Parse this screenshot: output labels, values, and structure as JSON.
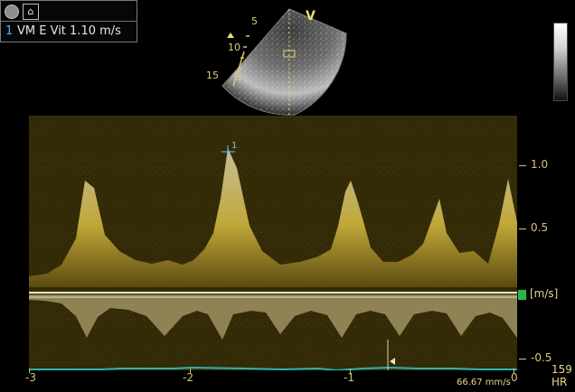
{
  "top_panel": {
    "record_icon": "record-icon",
    "patient_icon": "patient-icon",
    "measurement": {
      "index": "1",
      "label": "VM E Vit  1.10 m/s"
    }
  },
  "sector": {
    "mode_label": "V",
    "depth_labels": [
      "5",
      "10",
      "15"
    ]
  },
  "doppler": {
    "velocity_ticks": [
      {
        "label": "1.0",
        "value": 1.0
      },
      {
        "label": "0.5",
        "value": 0.5
      },
      {
        "label": "-0.5",
        "value": -0.5
      }
    ],
    "unit_label": "[m/s]",
    "time_ticks": [
      "-3",
      "-2",
      "-1",
      "0"
    ],
    "sweep_speed": "66.67 mm/s",
    "heart_rate_value": "159",
    "heart_rate_label": "HR",
    "cursor_label": "1"
  },
  "colors": {
    "background": "#000000",
    "accent": "#f2df6b",
    "measurement_index": "#5ab0ff",
    "green_marker": "#29b74a"
  }
}
